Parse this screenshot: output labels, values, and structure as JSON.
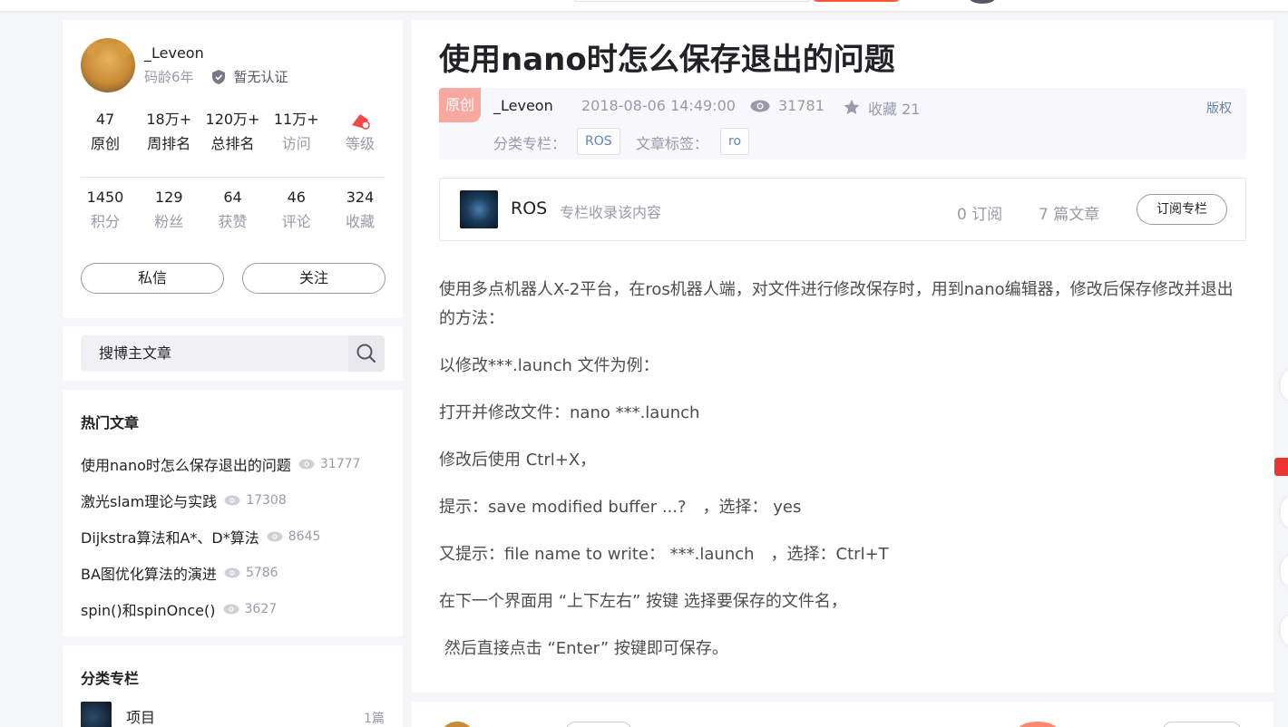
{
  "profile": {
    "username": "_Leveon",
    "code_age": "码龄6年",
    "certification": "暂无认证",
    "stats_top": [
      {
        "num": "47",
        "label": "原创"
      },
      {
        "num": "18万+",
        "label": "周排名"
      },
      {
        "num": "120万+",
        "label": "总排名"
      },
      {
        "num": "11万+",
        "label": "访问"
      },
      {
        "num": "",
        "label": "等级"
      }
    ],
    "stats_bottom": [
      {
        "num": "1450",
        "label": "积分"
      },
      {
        "num": "129",
        "label": "粉丝"
      },
      {
        "num": "64",
        "label": "获赞"
      },
      {
        "num": "46",
        "label": "评论"
      },
      {
        "num": "324",
        "label": "收藏"
      }
    ],
    "message_button": "私信",
    "follow_button": "关注"
  },
  "search": {
    "placeholder": "搜博主文章"
  },
  "hot_articles": {
    "title": "热门文章",
    "items": [
      {
        "title": "使用nano时怎么保存退出的问题",
        "views": "31777"
      },
      {
        "title": "激光slam理论与实践",
        "views": "17308"
      },
      {
        "title": "Dijkstra算法和A*、D*算法",
        "views": "8645"
      },
      {
        "title": "BA图优化算法的演进",
        "views": "5786"
      },
      {
        "title": "spin()和spinOnce()",
        "views": "3627"
      }
    ]
  },
  "categories": {
    "title": "分类专栏",
    "items": [
      {
        "name": "项目",
        "count": "1篇"
      }
    ]
  },
  "article": {
    "title": "使用nano时怎么保存退出的问题",
    "badge": "原创",
    "author": "_Leveon",
    "date": "2018-08-06 14:49:00",
    "views": "31781",
    "favorites": "收藏 21",
    "copyright": "版权",
    "category_label": "分类专栏：",
    "category_tag": "ROS",
    "tag_label": "文章标签：",
    "tag": "ro",
    "column": {
      "name": "ROS",
      "desc": "专栏收录该内容",
      "subscribers": "0 订阅",
      "articles": "7 篇文章",
      "subscribe_button": "订阅专栏"
    },
    "paragraphs": [
      "使用多点机器人X-2平台，在ros机器人端，对文件进行修改保存时，用到nano编辑器，修改后保存修改并退出的方法：",
      "以修改***.launch 文件为例：",
      "打开并修改文件：nano ***.launch",
      "修改后使用 Ctrl+X，",
      "提示：save modified buffer ...?　，选择： yes",
      "又提示：file name to write： ***.launch　，选择：Ctrl+T",
      "在下一个界面用 “上下左右” 按键 选择要保存的文件名，",
      " 然后直接点击 “Enter” 按键即可保存。"
    ]
  },
  "colors": {
    "accent": "#fc5531",
    "badge": "#f9a8a0",
    "link": "#5f86b6",
    "muted": "#999aaa"
  }
}
